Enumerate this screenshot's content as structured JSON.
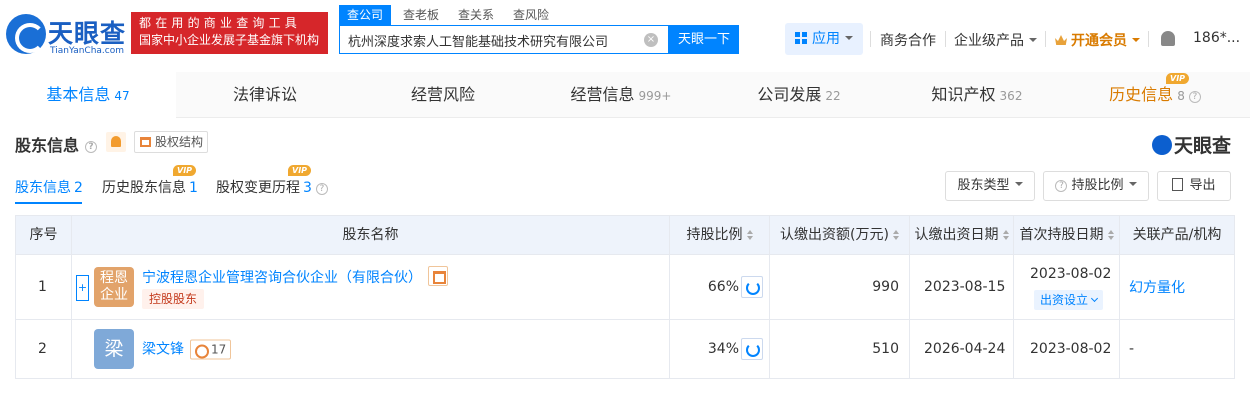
{
  "header": {
    "logo_name": "天眼查",
    "logo_url": "TianYanCha.com",
    "slogan_line1": "都在用的商业查询工具",
    "slogan_line2": "国家中小企业发展子基金旗下机构",
    "search_tabs": [
      "查公司",
      "查老板",
      "查关系",
      "查风险"
    ],
    "search_value": "杭州深度求索人工智能基础技术研究有限公司",
    "clear_label": "×",
    "search_button": "天眼一下",
    "nav": {
      "apps": "应用",
      "business": "商务合作",
      "enterprise": "企业级产品",
      "vip": "开通会员",
      "user": "186*..."
    }
  },
  "main_tabs": [
    {
      "label": "基本信息",
      "count": "47"
    },
    {
      "label": "法律诉讼",
      "count": ""
    },
    {
      "label": "经营风险",
      "count": ""
    },
    {
      "label": "经营信息",
      "count": "999+"
    },
    {
      "label": "公司发展",
      "count": "22"
    },
    {
      "label": "知识产权",
      "count": "362"
    },
    {
      "label": "历史信息",
      "count": "8"
    }
  ],
  "vip_label": "VIP",
  "help_mark": "?",
  "section": {
    "title": "股东信息",
    "equity_button": "股权结构",
    "brand": "天眼查",
    "subtabs": [
      {
        "label": "股东信息",
        "count": "2"
      },
      {
        "label": "历史股东信息",
        "count": "1"
      },
      {
        "label": "股权变更历程",
        "count": "3"
      }
    ],
    "buttons": {
      "holder_type": "股东类型",
      "ratio": "持股比例",
      "export": "导出"
    }
  },
  "table": {
    "headers": [
      "序号",
      "股东名称",
      "持股比例",
      "认缴出资额(万元)",
      "认缴出资日期",
      "首次持股日期",
      "关联产品/机构"
    ],
    "rows": [
      {
        "index": "1",
        "expand": "+",
        "avatar_line1": "程恩",
        "avatar_line2": "企业",
        "name": "宁波程恩企业管理咨询合伙企业（有限合伙）",
        "tag": "控股股东",
        "ratio": "66%",
        "amount": "990",
        "sub_date": "2023-08-15",
        "first_date": "2023-08-02",
        "first_tag": "出资设立",
        "related": "幻方量化"
      },
      {
        "index": "2",
        "avatar": "梁",
        "name": "梁文锋",
        "rel_count": "17",
        "ratio": "34%",
        "amount": "510",
        "sub_date": "2026-04-24",
        "first_date": "2023-08-02",
        "related": "-"
      }
    ]
  }
}
